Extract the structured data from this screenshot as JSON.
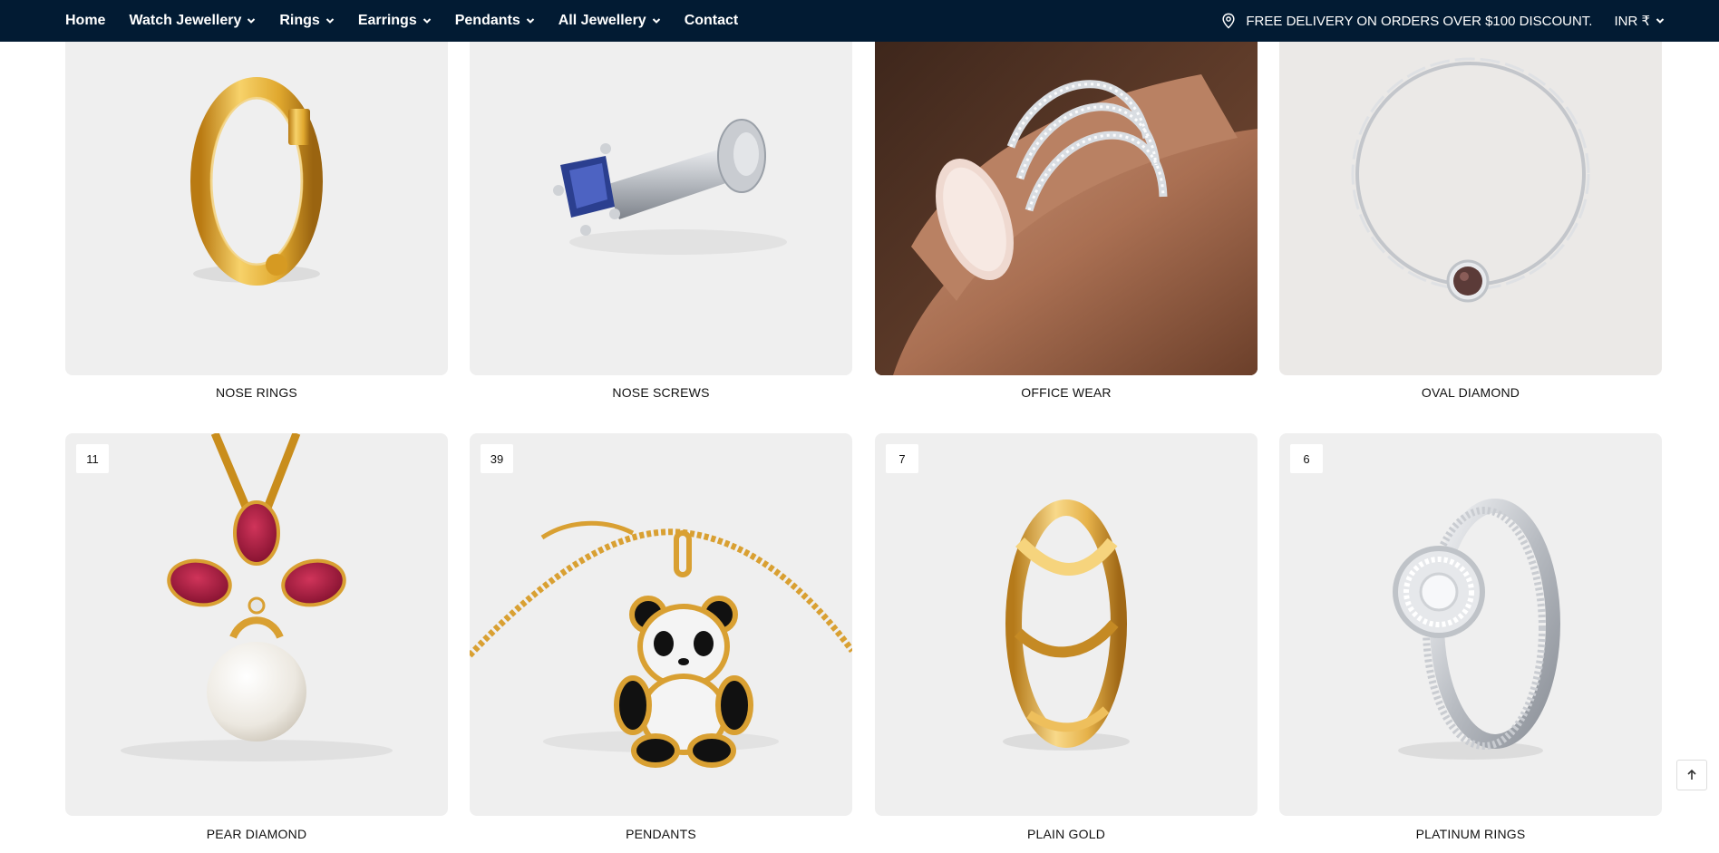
{
  "nav": {
    "items": [
      {
        "label": "Home",
        "dropdown": false
      },
      {
        "label": "Watch Jewellery",
        "dropdown": true
      },
      {
        "label": "Rings",
        "dropdown": true
      },
      {
        "label": "Earrings",
        "dropdown": true
      },
      {
        "label": "Pendants",
        "dropdown": true
      },
      {
        "label": "All Jewellery",
        "dropdown": true
      },
      {
        "label": "Contact",
        "dropdown": false
      }
    ],
    "promo_text": "FREE DELIVERY ON ORDERS OVER $100 DISCOUNT.",
    "currency": "INR ₹"
  },
  "categories": [
    {
      "label": "NOSE RINGS",
      "count": "",
      "icon": "nose-ring-hoop"
    },
    {
      "label": "NOSE SCREWS",
      "count": "",
      "icon": "nose-screw-sapphire"
    },
    {
      "label": "OFFICE WEAR",
      "count": "",
      "icon": "diamond-band-on-finger"
    },
    {
      "label": "OVAL DIAMOND",
      "count": "",
      "icon": "chain-bracelet"
    },
    {
      "label": "PEAR DIAMOND",
      "count": "11",
      "icon": "ruby-pearl-pendant"
    },
    {
      "label": "PENDANTS",
      "count": "39",
      "icon": "panda-pendant"
    },
    {
      "label": "PLAIN GOLD",
      "count": "7",
      "icon": "twisted-gold-ring"
    },
    {
      "label": "PLATINUM RINGS",
      "count": "6",
      "icon": "halo-platinum-ring"
    }
  ],
  "colors": {
    "nav_bg": "#021b33",
    "card_bg": "#efefef",
    "gold": "#e0a82e",
    "silver": "#c8cbd0",
    "ruby": "#a3153a"
  }
}
